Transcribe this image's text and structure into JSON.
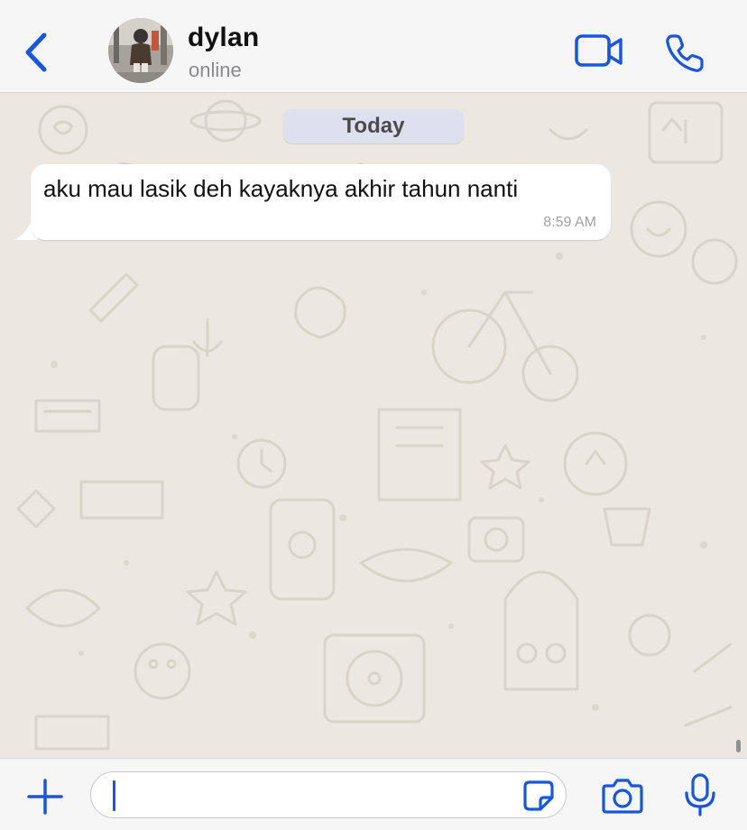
{
  "header": {
    "contact_name": "dylan",
    "status": "online",
    "icons": {
      "back": "chevron-left-icon",
      "video": "video-camera-icon",
      "call": "phone-icon"
    }
  },
  "chat": {
    "date_separator": "Today",
    "messages": [
      {
        "direction": "incoming",
        "text": "aku mau lasik deh kayaknya akhir tahun nanti",
        "time": "8:59 AM"
      }
    ]
  },
  "composer": {
    "value": "",
    "icons": {
      "attach": "plus-icon",
      "sticker": "sticker-icon",
      "camera": "camera-icon",
      "mic": "microphone-icon"
    }
  },
  "colors": {
    "accent": "#1a56db",
    "bubble_incoming": "#ffffff",
    "date_pill": "#dfe0ef",
    "chat_background": "#ece8e1"
  }
}
